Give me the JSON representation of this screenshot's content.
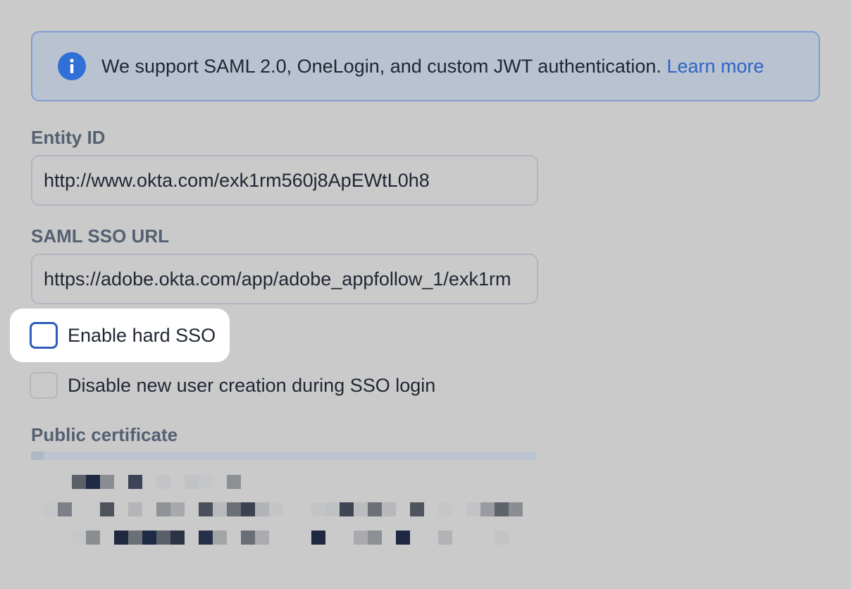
{
  "banner": {
    "text": "We support SAML 2.0, OneLogin, and custom JWT authentication.",
    "link": "Learn more",
    "icon": "info-icon"
  },
  "entity_id": {
    "label": "Entity ID",
    "value": "http://www.okta.com/exk1rm560j8ApEWtL0h8"
  },
  "sso_url": {
    "label": "SAML SSO URL",
    "value": "https://adobe.okta.com/app/adobe_appfollow_1/exk1rm"
  },
  "options": [
    {
      "label": "Enable hard SSO",
      "checked": false,
      "focused": true
    },
    {
      "label": "Disable new user creation during SSO login",
      "checked": false,
      "focused": false
    }
  ],
  "certificate": {
    "label": "Public certificate",
    "obscured": true
  },
  "colors": {
    "background": "#cacaca",
    "accent": "#2f6fd6",
    "link": "#2f64c6",
    "banner_bg": "#b8c2d0",
    "banner_border": "#7f9dd3"
  }
}
